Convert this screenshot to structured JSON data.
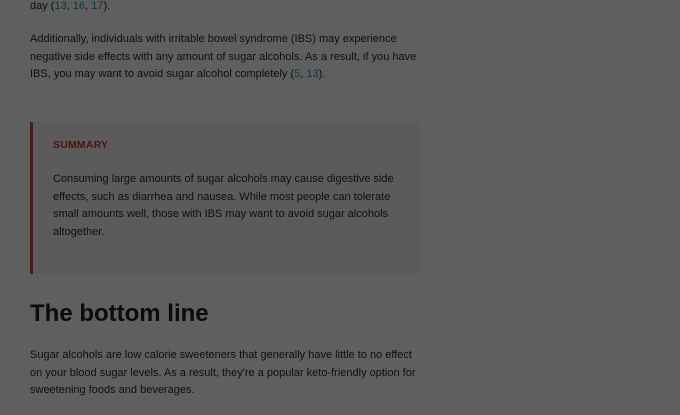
{
  "para1": {
    "prefix": "day (",
    "refs": [
      "13",
      "16",
      "17"
    ],
    "suffix": ")."
  },
  "para2": {
    "text": "Additionally, individuals with irritable bowel syndrome (IBS) may experience negative side effects with any amount of sugar alcohols. As a result, if you have IBS, you may want to avoid sugar alcohol completely (",
    "refs": [
      "5",
      "13"
    ],
    "suffix": ")."
  },
  "summary": {
    "label": "SUMMARY",
    "text": "Consuming large amounts of sugar alcohols may cause digestive side effects, such as diarrhea and nausea. While most people can tolerate small amounts well, those with IBS may want to avoid sugar alcohols altogether."
  },
  "heading": "The bottom line",
  "para3": {
    "text": "Sugar alcohols are low calorie sweeteners that generally have little to no effect on your blood sugar levels. As a result, they're a popular keto-friendly option for sweetening foods and beverages."
  },
  "colors": {
    "link": "#1a7f9c",
    "summary_accent": "#b03a2e"
  }
}
